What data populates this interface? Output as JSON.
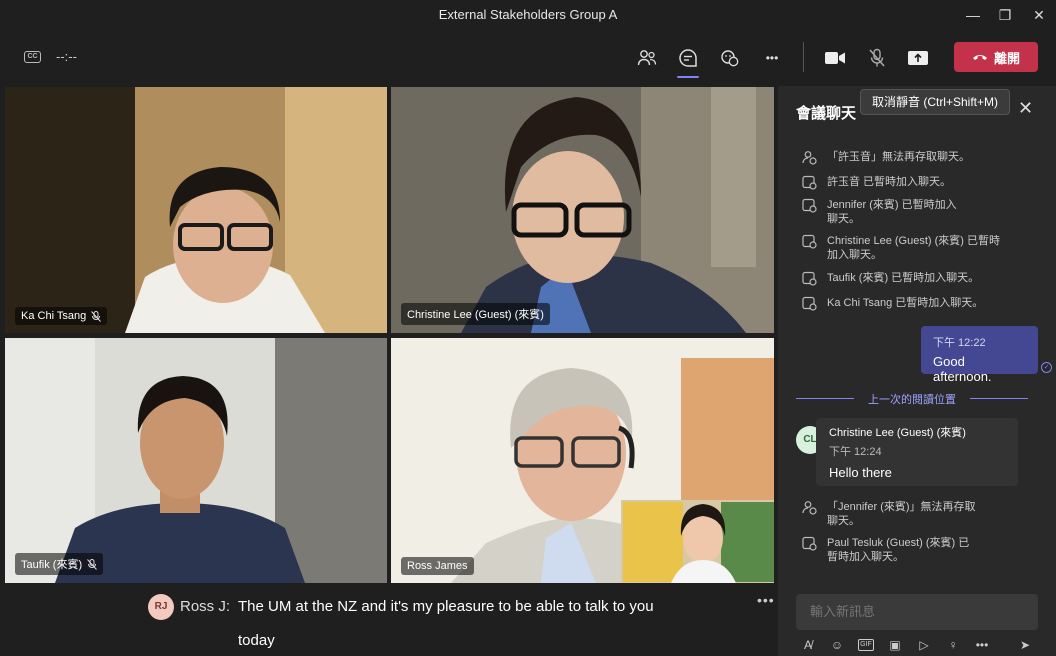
{
  "window": {
    "title": "External Stakeholders Group A",
    "minimize_glyph": "—",
    "maximize_glyph": "❐",
    "close_glyph": "✕"
  },
  "toolbar": {
    "timer": "--:--",
    "leave_label": "離開",
    "more_glyph": "•••"
  },
  "tooltip": "取消靜音 (Ctrl+Shift+M)",
  "participants": [
    {
      "name": "Ka Chi Tsang",
      "muted": true
    },
    {
      "name": "Christine Lee (Guest) (來賓)",
      "muted": false
    },
    {
      "name": "Taufik (來賓)",
      "muted": true
    },
    {
      "name": "Ross James",
      "muted": false
    }
  ],
  "caption": {
    "initials": "RJ",
    "speaker": "Ross J:",
    "text": "The UM at the NZ and it's my pleasure to be able to talk to you today",
    "more_glyph": "•••"
  },
  "chat": {
    "title": "會議聊天",
    "close_glyph": "✕",
    "system_messages": [
      "「許玉音」無法再存取聊天。",
      "許玉音 已暫時加入聊天。",
      "Jennifer (來賓) 已暫時加入聊天。",
      "Christine Lee (Guest) (來賓) 已暫時加入聊天。",
      "Taufik (來賓) 已暫時加入聊天。",
      "Ka Chi Tsang 已暫時加入聊天。"
    ],
    "my_message": {
      "time": "下午 12:22",
      "text": "Good afternoon."
    },
    "read_marker": "上一次的閱讀位置",
    "their_message": {
      "initials": "CL",
      "sender": "Christine Lee (Guest) (來賓)",
      "time": "下午 12:24",
      "text": "Hello there"
    },
    "later_messages": [
      "「Jennifer (來賓)」無法再存取聊天。",
      "Paul Tesluk (Guest) (來賓) 已暫時加入聊天。"
    ],
    "input_placeholder": "輸入新訊息"
  }
}
